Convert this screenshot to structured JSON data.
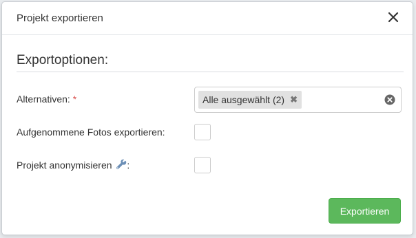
{
  "dialog": {
    "title": "Projekt exportieren",
    "close_icon": "close-icon"
  },
  "section": {
    "title": "Exportoptionen:"
  },
  "fields": {
    "alternatives": {
      "label": "Alternativen:",
      "required_mark": "*",
      "selected_chip": "Alle ausgewählt (2)",
      "chip_remove": "✖",
      "clear_icon": "clear-circle-icon"
    },
    "export_photos": {
      "label": "Aufgenommene Fotos exportieren:",
      "checked": false
    },
    "anonymize": {
      "label": "Projekt anonymisieren",
      "label_suffix": ":",
      "icon": "wrench-icon",
      "checked": false
    }
  },
  "footer": {
    "export_label": "Exportieren"
  },
  "colors": {
    "primary_button": "#5cb85c",
    "required": "#d9534f"
  }
}
